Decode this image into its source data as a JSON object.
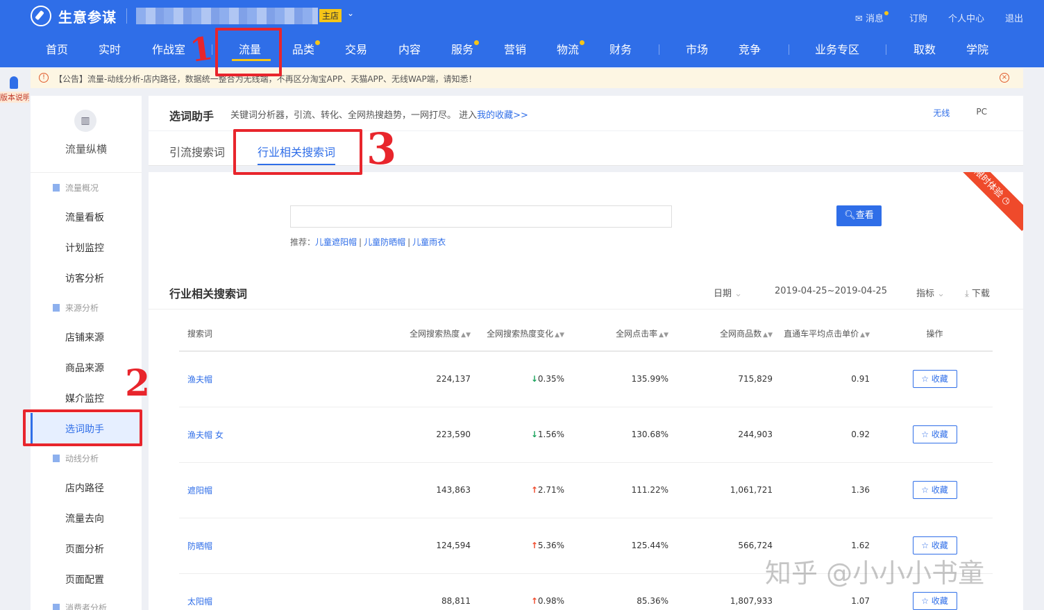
{
  "header": {
    "brand": "生意参谋",
    "shop_badge": "主店",
    "top_links": [
      "消息",
      "订购",
      "个人中心",
      "退出"
    ],
    "nav": [
      {
        "label": "首页"
      },
      {
        "label": "实时"
      },
      {
        "label": "作战室"
      },
      {
        "label": "流量",
        "active": true
      },
      {
        "label": "品类",
        "dot": true
      },
      {
        "label": "交易"
      },
      {
        "label": "内容"
      },
      {
        "label": "服务",
        "dot": true
      },
      {
        "label": "营销"
      },
      {
        "label": "物流",
        "dot": true
      },
      {
        "label": "财务"
      },
      {
        "label": "市场"
      },
      {
        "label": "竞争"
      },
      {
        "label": "业务专区"
      },
      {
        "label": "取数"
      },
      {
        "label": "学院"
      }
    ]
  },
  "notice": {
    "text": "【公告】流量-动线分析-店内路径，数据统一整合为无线端，不再区分淘宝APP、天猫APP、无线WAP端，请知悉！",
    "version_label": "版本说明"
  },
  "sidebar": {
    "title": "流量纵横",
    "groups": {
      "overview": "流量概况",
      "source": "来源分析",
      "flow": "动线分析",
      "consumer": "消费者分析"
    },
    "items": {
      "board": "流量看板",
      "plan": "计划监控",
      "visitor": "访客分析",
      "shop_source": "店铺来源",
      "item_source": "商品来源",
      "media": "媒介监控",
      "keyword_helper": "选词助手",
      "path": "店内路径",
      "direction": "流量去向",
      "page_analysis": "页面分析",
      "page_config": "页面配置"
    }
  },
  "helper": {
    "title": "选词助手",
    "desc": "关键词分析器，引流、转化、全网热搜趋势，一网打尽。 进入",
    "fav_link": "我的收藏>>",
    "platform_wireless": "无线",
    "platform_pc": "PC"
  },
  "tabs": [
    "引流搜索词",
    "行业相关搜索词"
  ],
  "search": {
    "button": "查看",
    "suggest_prefix": "推荐：",
    "suggestions": [
      "儿童遮阳帽",
      "儿童防晒帽",
      "儿童雨衣"
    ],
    "ribbon": "限时体验"
  },
  "section": {
    "title": "行业相关搜索词",
    "date_label": "日期",
    "date_range": "2019-04-25~2019-04-25",
    "metric_label": "指标",
    "download": "下载"
  },
  "table": {
    "headers": [
      "搜索词",
      "全网搜索热度",
      "全网搜索热度变化",
      "全网点击率",
      "全网商品数",
      "直通车平均点击单价",
      "操作"
    ],
    "fav_label": "收藏",
    "rows": [
      {
        "kw": "渔夫帽",
        "heat": "224,137",
        "dir": "down",
        "change": "0.35%",
        "ctr": "135.99%",
        "items": "715,829",
        "cpc": "0.91"
      },
      {
        "kw": "渔夫帽 女",
        "heat": "223,590",
        "dir": "down",
        "change": "1.56%",
        "ctr": "130.68%",
        "items": "244,903",
        "cpc": "0.92"
      },
      {
        "kw": "遮阳帽",
        "heat": "143,863",
        "dir": "up",
        "change": "2.71%",
        "ctr": "111.22%",
        "items": "1,061,721",
        "cpc": "1.36"
      },
      {
        "kw": "防晒帽",
        "heat": "124,594",
        "dir": "up",
        "change": "5.36%",
        "ctr": "125.44%",
        "items": "566,724",
        "cpc": "1.62"
      },
      {
        "kw": "太阳帽",
        "heat": "88,811",
        "dir": "up",
        "change": "0.98%",
        "ctr": "85.36%",
        "items": "1,807,933",
        "cpc": "1.07"
      }
    ]
  },
  "annotations": [
    "1",
    "2",
    "3"
  ],
  "watermark": "知乎 @小小小书童",
  "colors": {
    "primary": "#2f6ee8",
    "highlight": "#f5c518",
    "annotation": "#e8252c",
    "down": "#1aa35c",
    "up": "#ef4a2b"
  }
}
